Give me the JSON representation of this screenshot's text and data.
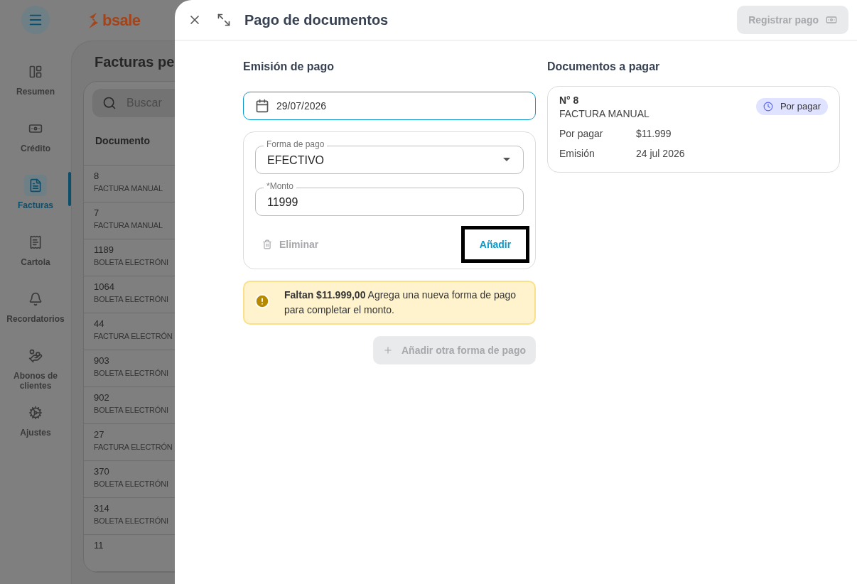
{
  "app": {
    "logo": "bsale"
  },
  "sidebar": {
    "items": [
      {
        "kind": "summary",
        "label": "Resumen",
        "selected": false
      },
      {
        "kind": "credit",
        "label": "Crédito",
        "selected": false
      },
      {
        "kind": "invoices",
        "label": "Facturas",
        "selected": true
      },
      {
        "kind": "statement",
        "label": "Cartola",
        "selected": false
      },
      {
        "kind": "reminders",
        "label": "Recordatorios",
        "selected": false
      },
      {
        "kind": "payments",
        "label": "Abonos de clientes",
        "selected": false
      },
      {
        "kind": "settings",
        "label": "Ajustes",
        "selected": false
      }
    ]
  },
  "page": {
    "title": "Facturas pe",
    "search": {
      "placeholder": "Buscar"
    },
    "table": {
      "columns": [
        "Documento"
      ],
      "rows": [
        {
          "number": "8",
          "type": "FACTURA MANUAL"
        },
        {
          "number": "7",
          "type": "FACTURA MANUAL"
        },
        {
          "number": "1189",
          "type": "BOLETA ELECTRÓNI"
        },
        {
          "number": "1064",
          "type": "BOLETA ELECTRÓNI"
        },
        {
          "number": "44",
          "type": "FACTURA ELECTRÓN"
        },
        {
          "number": "903",
          "type": "BOLETA ELECTRÓNI"
        },
        {
          "number": "902",
          "type": "BOLETA ELECTRÓNI"
        },
        {
          "number": "27",
          "type": "FACTURA ELECTRÓN"
        },
        {
          "number": "370",
          "type": "BOLETA ELECTRÓNI"
        },
        {
          "number": "314",
          "type": "BOLETA ELECTRÓNI"
        },
        {
          "number": "11"
        }
      ]
    }
  },
  "dialog": {
    "title": "Pago de documentos",
    "register_button": {
      "label": "Registrar pago",
      "disabled": true
    },
    "payment": {
      "heading": "Emisión de pago",
      "date": "29/07/2026",
      "method": {
        "label": "Forma de pago",
        "value": "EFECTIVO"
      },
      "amount": {
        "label": "*Monto",
        "value": "11999"
      },
      "delete_button": {
        "label": "Eliminar",
        "disabled": true
      },
      "add_button": {
        "label": "Añadir",
        "focused": true
      },
      "alert": {
        "text": "**Faltan $11.999,00** Agrega una nueva forma de pago para completar el monto."
      },
      "add_other_button": {
        "label": "Añadir otra forma de pago",
        "disabled": true
      }
    },
    "documents": {
      "heading": "Documentos a pagar",
      "items": [
        {
          "number": "N° 8",
          "type": "FACTURA MANUAL",
          "status": "Por pagar",
          "rows": [
            {
              "label": "Por pagar",
              "value": "$11.999"
            },
            {
              "label": "Emisión",
              "value": "24 jul 2026"
            }
          ]
        }
      ]
    }
  }
}
